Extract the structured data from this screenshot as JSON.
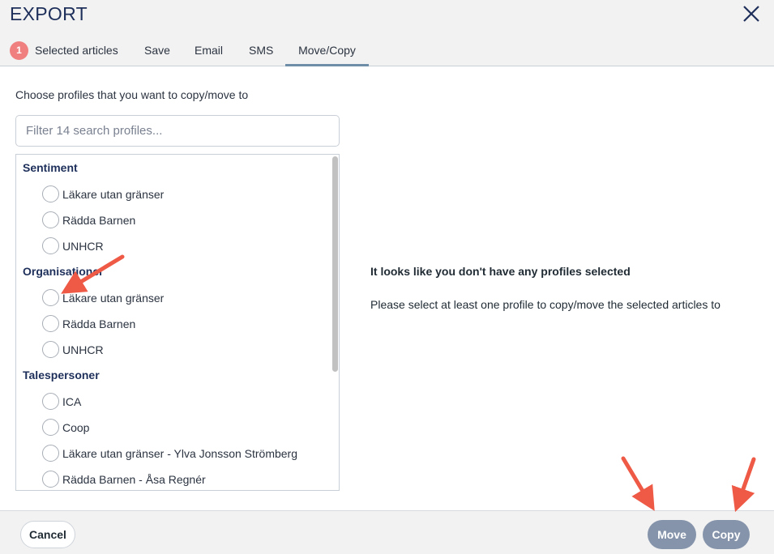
{
  "dialog": {
    "title": "EXPORT",
    "close_icon": "close-icon"
  },
  "tabs": [
    {
      "label": "Selected articles",
      "badge": "1"
    },
    {
      "label": "Save"
    },
    {
      "label": "Email"
    },
    {
      "label": "SMS"
    },
    {
      "label": "Move/Copy",
      "active": true
    }
  ],
  "content": {
    "instructions": "Choose profiles that you want to copy/move to",
    "filter_placeholder": "Filter 14 search profiles...",
    "groups": [
      {
        "title": "Sentiment",
        "items": [
          "Läkare utan gränser",
          "Rädda Barnen",
          "UNHCR"
        ]
      },
      {
        "title": "Organisationer",
        "items": [
          "Läkare utan gränser",
          "Rädda Barnen",
          "UNHCR"
        ]
      },
      {
        "title": "Talespersoner",
        "items": [
          "ICA",
          "Coop",
          "Läkare utan gränser - Ylva Jonsson Strömberg",
          "Rädda Barnen - Åsa Regnér"
        ]
      }
    ],
    "message_title": "It looks like you don't have any profiles selected",
    "message_body": "Please select at least one profile to copy/move the selected articles to"
  },
  "footer": {
    "cancel_label": "Cancel",
    "move_label": "Move",
    "copy_label": "Copy"
  },
  "colors": {
    "accent": "#6e8ea8",
    "badge": "#f08080",
    "button": "#8594aa",
    "annotation_arrow": "#ee5a45"
  }
}
